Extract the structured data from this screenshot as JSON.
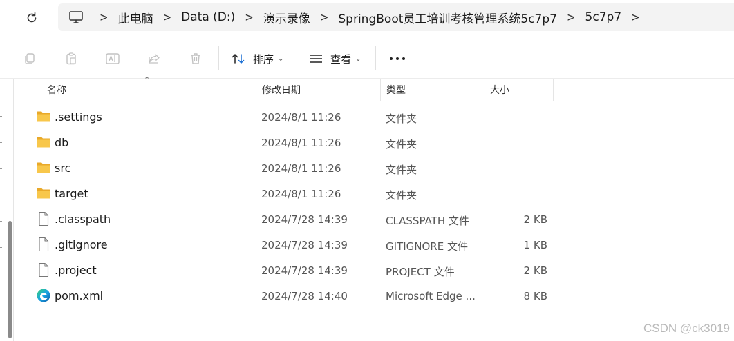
{
  "address_bar": {
    "crumbs": [
      "此电脑",
      "Data (D:)",
      "演示录像",
      "SpringBoot员工培训考核管理系统5c7p7",
      "5c7p7"
    ]
  },
  "toolbar": {
    "sort_label": "排序",
    "view_label": "查看"
  },
  "columns": {
    "name": "名称",
    "modified": "修改日期",
    "type": "类型",
    "size": "大小"
  },
  "files": [
    {
      "name": ".settings",
      "modified": "2024/8/1 11:26",
      "type": "文件夹",
      "size": "",
      "icon": "folder-icon"
    },
    {
      "name": "db",
      "modified": "2024/8/1 11:26",
      "type": "文件夹",
      "size": "",
      "icon": "folder-icon"
    },
    {
      "name": "src",
      "modified": "2024/8/1 11:26",
      "type": "文件夹",
      "size": "",
      "icon": "folder-icon"
    },
    {
      "name": "target",
      "modified": "2024/8/1 11:26",
      "type": "文件夹",
      "size": "",
      "icon": "folder-icon"
    },
    {
      "name": ".classpath",
      "modified": "2024/7/28 14:39",
      "type": "CLASSPATH 文件",
      "size": "2 KB",
      "icon": "file-icon"
    },
    {
      "name": ".gitignore",
      "modified": "2024/7/28 14:39",
      "type": "GITIGNORE 文件",
      "size": "1 KB",
      "icon": "file-icon"
    },
    {
      "name": ".project",
      "modified": "2024/7/28 14:39",
      "type": "PROJECT 文件",
      "size": "2 KB",
      "icon": "file-icon"
    },
    {
      "name": "pom.xml",
      "modified": "2024/7/28 14:40",
      "type": "Microsoft Edge ...",
      "size": "8 KB",
      "icon": "edge-icon"
    }
  ],
  "watermark": "CSDN @ck3019",
  "colors": {
    "folder": "#f8c74b",
    "folder_dark": "#e9a92a",
    "address_bg": "#f3f3f3"
  }
}
